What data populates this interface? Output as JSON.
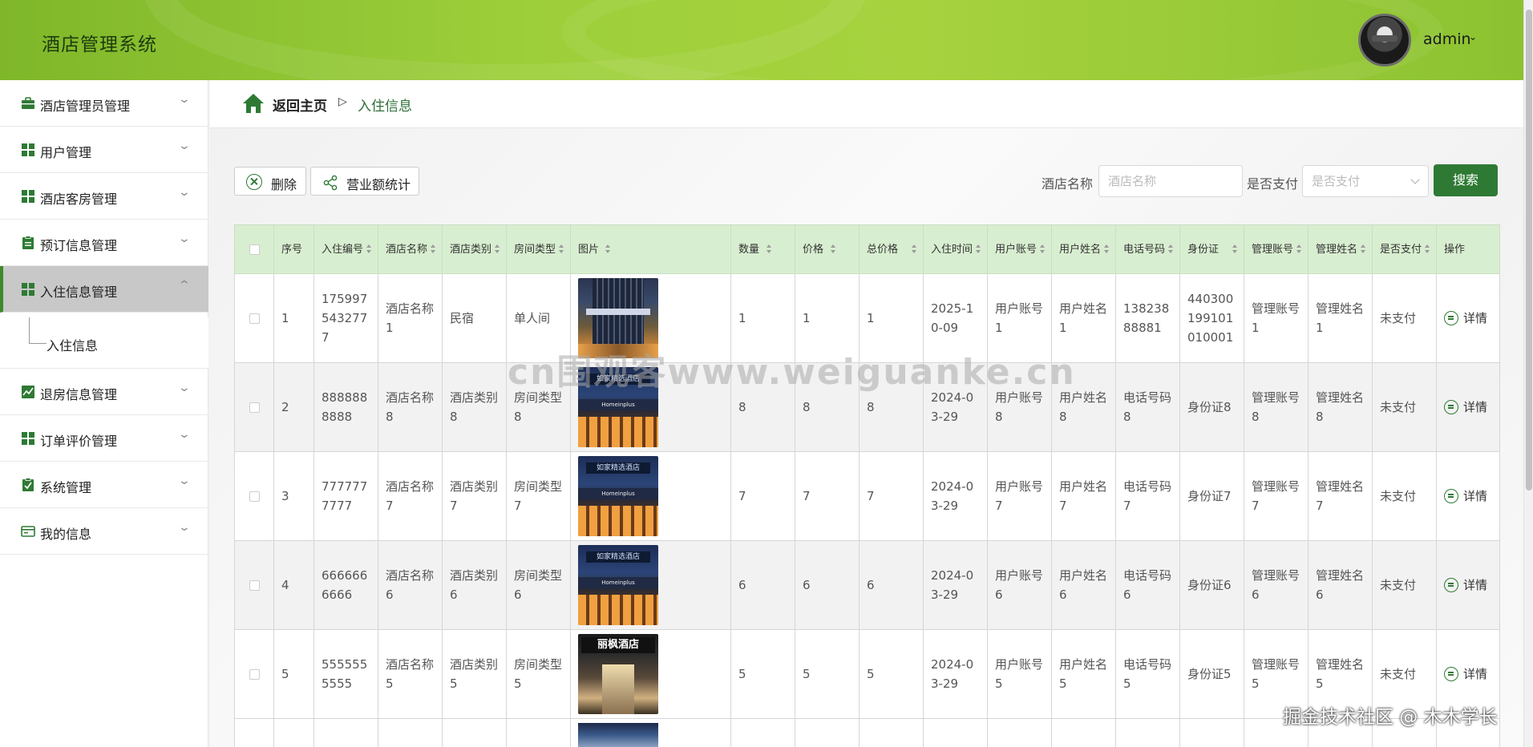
{
  "app": {
    "title": "酒店管理系统",
    "user": "admin"
  },
  "sidebar": {
    "items": [
      {
        "label": "酒店管理员管理",
        "icon": "briefcase-icon"
      },
      {
        "label": "用户管理",
        "icon": "grid-icon"
      },
      {
        "label": "酒店客房管理",
        "icon": "grid-icon"
      },
      {
        "label": "预订信息管理",
        "icon": "clipboard-icon"
      },
      {
        "label": "入住信息管理",
        "icon": "grid-icon"
      },
      {
        "label": "退房信息管理",
        "icon": "chart-icon"
      },
      {
        "label": "订单评价管理",
        "icon": "grid-icon"
      },
      {
        "label": "系统管理",
        "icon": "clipboard-check-icon"
      },
      {
        "label": "我的信息",
        "icon": "card-icon"
      }
    ],
    "sub_item": "入住信息"
  },
  "breadcrumb": {
    "home": "返回主页",
    "separator": "▷",
    "current": "入住信息"
  },
  "toolbar": {
    "delete_label": "删除",
    "stats_label": "营业额统计",
    "hotel_name_label": "酒店名称",
    "hotel_name_placeholder": "酒店名称",
    "paid_label": "是否支付",
    "paid_placeholder": "是否支付",
    "search_label": "搜索"
  },
  "table": {
    "headers": [
      "序号",
      "入住编号",
      "酒店名称",
      "酒店类别",
      "房间类型",
      "图片",
      "数量",
      "价格",
      "总价格",
      "入住时间",
      "用户账号",
      "用户姓名",
      "电话号码",
      "身份证",
      "管理账号",
      "管理姓名",
      "是否支付",
      "操作"
    ],
    "action_label": "详情",
    "rows": [
      [
        "1",
        "1759975432777",
        "酒店名称1",
        "民宿",
        "单人间",
        "1",
        "1",
        "1",
        "2025-10-09",
        "用户账号1",
        "用户姓名1",
        "13823888881",
        "440300199101010001",
        "管理账号1",
        "管理姓名1",
        "未支付"
      ],
      [
        "2",
        "8888888888",
        "酒店名称8",
        "酒店类别8",
        "房间类型8",
        "8",
        "8",
        "8",
        "2024-03-29",
        "用户账号8",
        "用户姓名8",
        "电话号码8",
        "身份证8",
        "管理账号8",
        "管理姓名8",
        "未支付"
      ],
      [
        "3",
        "7777777777",
        "酒店名称7",
        "酒店类别7",
        "房间类型7",
        "7",
        "7",
        "7",
        "2024-03-29",
        "用户账号7",
        "用户姓名7",
        "电话号码7",
        "身份证7",
        "管理账号7",
        "管理姓名7",
        "未支付"
      ],
      [
        "4",
        "6666666666",
        "酒店名称6",
        "酒店类别6",
        "房间类型6",
        "6",
        "6",
        "6",
        "2024-03-29",
        "用户账号6",
        "用户姓名6",
        "电话号码6",
        "身份证6",
        "管理账号6",
        "管理姓名6",
        "未支付"
      ],
      [
        "5",
        "5555555555",
        "酒店名称5",
        "酒店类别5",
        "房间类型5",
        "5",
        "5",
        "5",
        "2024-03-29",
        "用户账号5",
        "用户姓名5",
        "电话号码5",
        "身份证5",
        "管理账号5",
        "管理姓名5",
        "未支付"
      ]
    ],
    "image_styles": [
      "hotel-tower",
      "hotel-homeinplus",
      "hotel-homeinplus",
      "hotel-homeinplus",
      "hotel-lifeng"
    ],
    "image_signs": [
      "",
      "如家精选酒店",
      "如家精选酒店",
      "如家精选酒店",
      "丽枫酒店"
    ]
  },
  "watermark": "cn围观客www.weiguanke.cn",
  "credit": "掘金技术社区 @ 木木学长",
  "colors": {
    "accent": "#2e7a34",
    "header": "#9dcf3a",
    "table_header": "#d8eed0"
  }
}
